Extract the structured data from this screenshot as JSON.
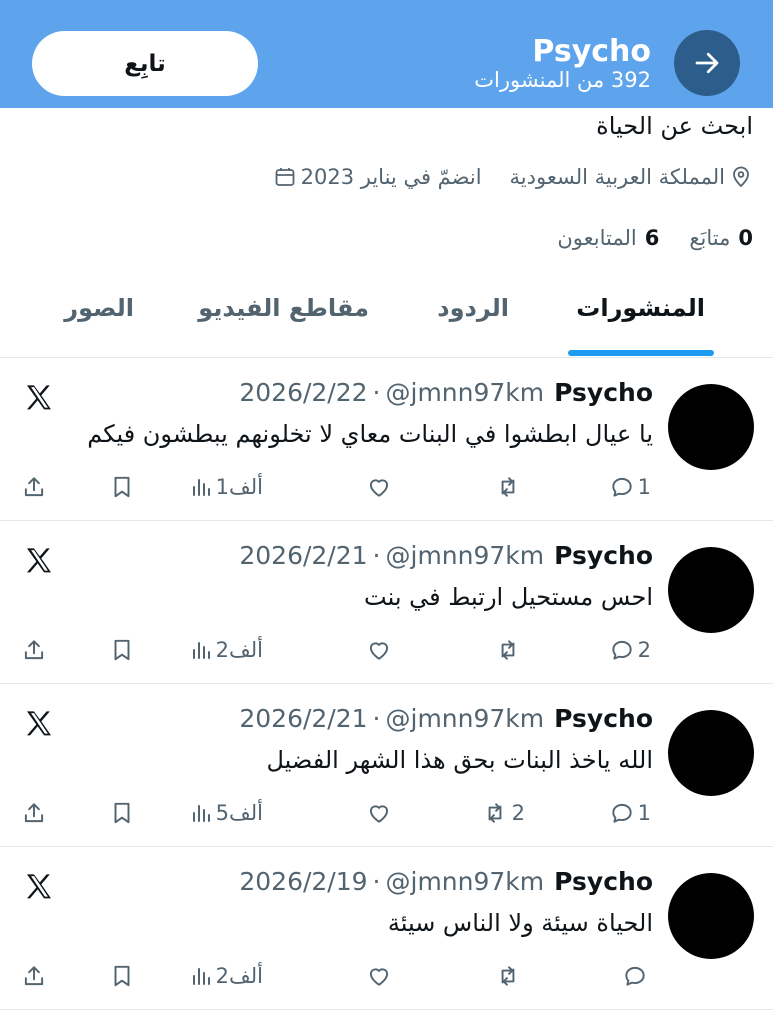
{
  "header": {
    "title": "Psycho",
    "subtitle": "392 من المنشورات",
    "follow_label": "تابِع"
  },
  "profile": {
    "bio": "ابحث عن الحياة",
    "location": "المملكة العربية السعودية",
    "joined": "انضمّ في يناير 2023",
    "following_count": "0",
    "following_label": "متابَع",
    "followers_count": "6",
    "followers_label": "المتابعون"
  },
  "tabs": [
    {
      "label": "المنشورات",
      "active": true
    },
    {
      "label": "الردود",
      "active": false
    },
    {
      "label": "مقاطع الفيديو",
      "active": false
    },
    {
      "label": "الصور",
      "active": false
    }
  ],
  "posts": [
    {
      "name": "Psycho",
      "handle": "@jmnn97km",
      "dot": "·",
      "date": "2026/2/22",
      "text": "يا عيال ابطشوا في البنات معاي لا تخلونهم يبطشون فيكم",
      "replies": "1",
      "reposts": "",
      "views": "1ألف"
    },
    {
      "name": "Psycho",
      "handle": "@jmnn97km",
      "dot": "·",
      "date": "2026/2/21",
      "text": "احس مستحيل ارتبط في بنت",
      "replies": "2",
      "reposts": "",
      "views": "2ألف"
    },
    {
      "name": "Psycho",
      "handle": "@jmnn97km",
      "dot": "·",
      "date": "2026/2/21",
      "text": "الله ياخذ البنات بحق هذا الشهر الفضيل",
      "replies": "1",
      "reposts": "2",
      "views": "5ألف"
    },
    {
      "name": "Psycho",
      "handle": "@jmnn97km",
      "dot": "·",
      "date": "2026/2/19",
      "text": "الحياة سيئة ولا الناس سيئة",
      "replies": "",
      "reposts": "",
      "views": "2ألف"
    }
  ],
  "icons": {
    "back": "arrow-right-icon",
    "location": "location-pin-icon",
    "calendar": "calendar-icon",
    "x_logo": "x-logo-icon",
    "reply": "reply-icon",
    "repost": "repost-icon",
    "like": "heart-icon",
    "views": "views-icon",
    "bookmark": "bookmark-icon",
    "share": "share-icon"
  },
  "colors": {
    "header_bg": "#5ea4ec",
    "back_button_bg": "#2d5e8b",
    "accent": "#1d9bf0",
    "secondary_text": "#536471"
  }
}
